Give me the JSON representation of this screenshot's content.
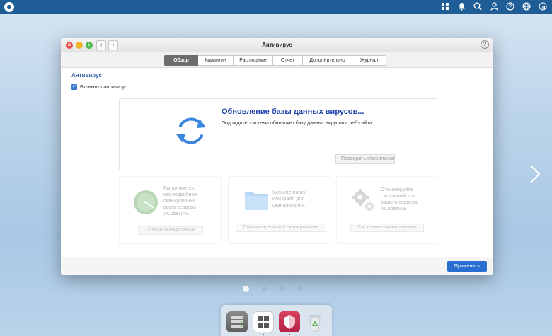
{
  "topbar": {
    "logo": "qnap-logo",
    "icons": [
      "grid-icon",
      "bell-icon",
      "search-icon",
      "user-icon",
      "help-icon",
      "globe-icon",
      "dashboard-icon"
    ]
  },
  "window": {
    "title": "Антивирус",
    "help": "?",
    "tabs": [
      {
        "label": "Обзор",
        "active": true
      },
      {
        "label": "Карантин",
        "active": false
      },
      {
        "label": "Расписание",
        "active": false
      },
      {
        "label": "Отчет",
        "active": false
      },
      {
        "label": "Дополнительно",
        "active": false
      },
      {
        "label": "Журнал",
        "active": false
      }
    ],
    "section_title": "Антивирус",
    "enable_label": "Включить антивирус",
    "enabled": true,
    "update": {
      "title": "Обновление базы данных вирусов...",
      "description": "Подождите, система обновляет базу данных вирусов с веб-сайта.",
      "check_button": "Проверить обновления"
    },
    "cards": [
      {
        "text": [
          "Выполняется",
          "как подробное",
          "сканирование",
          "всего сервера",
          "XCubeNAS."
        ],
        "button": "Полное сканирование"
      },
      {
        "text": [
          "Укажите папку",
          "или файл для",
          "сканирования."
        ],
        "button": "Пользовательское сканирование"
      },
      {
        "text": [
          "Отсканируйте",
          "системный том",
          "вашего сервера",
          "XCubeNAS."
        ],
        "button": "Системное сканирование"
      }
    ],
    "apply_button": "Применить"
  },
  "pager": {
    "count": 4,
    "active": 0
  },
  "dock": {
    "apps": [
      "storage-app-icon",
      "app-center-icon",
      "antivirus-shield-icon",
      "recycle-bin-icon"
    ]
  },
  "colors": {
    "topbar": "#1f5d96",
    "accent": "#2b6ed1",
    "title_blue": "#1b3fa8",
    "sync_blue": "#3d86e0"
  }
}
